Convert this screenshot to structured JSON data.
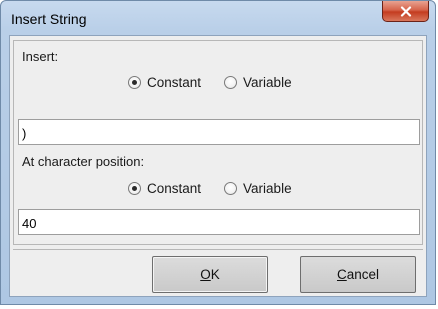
{
  "window": {
    "title": "Insert String",
    "close_icon": "close-icon"
  },
  "insert": {
    "label": "Insert:",
    "options": [
      {
        "label": "Constant",
        "selected": true
      },
      {
        "label": "Variable",
        "selected": false
      }
    ],
    "value": ")"
  },
  "position": {
    "label": "At character position:",
    "options": [
      {
        "label": "Constant",
        "selected": true
      },
      {
        "label": "Variable",
        "selected": false
      }
    ],
    "value": "40"
  },
  "buttons": {
    "ok": {
      "mnemonic": "O",
      "rest": "K"
    },
    "cancel": {
      "mnemonic": "C",
      "rest": "ancel"
    }
  },
  "colors": {
    "title_gradient_top": "#c7d9ee",
    "close_button": "#c43c20",
    "client_bg": "#eeeeee"
  }
}
